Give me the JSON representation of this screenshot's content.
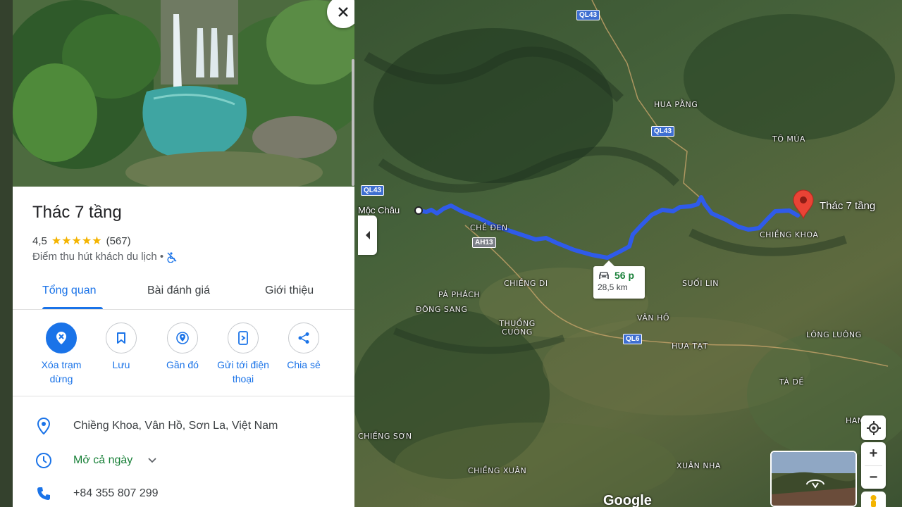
{
  "place": {
    "title": "Thác 7 tầng",
    "rating": "4,5",
    "stars": "★★★★★",
    "review_count": "(567)",
    "category": "Điểm thu hút khách du lịch •"
  },
  "tabs": [
    "Tổng quan",
    "Bài đánh giá",
    "Giới thiệu"
  ],
  "actions": [
    {
      "label": "Xóa trạm dừng",
      "icon": "remove-stop-icon"
    },
    {
      "label": "Lưu",
      "icon": "bookmark-icon"
    },
    {
      "label": "Gần đó",
      "icon": "nearby-icon"
    },
    {
      "label": "Gửi tới điện thoại",
      "icon": "send-to-phone-icon"
    },
    {
      "label": "Chia sẻ",
      "icon": "share-icon"
    }
  ],
  "info": {
    "address": "Chiềng Khoa, Vân Hồ, Sơn La, Việt Nam",
    "hours": "Mở cả ngày",
    "phone": "+84 355 807 299"
  },
  "route": {
    "duration": "56 p",
    "distance": "28,5 km"
  },
  "map": {
    "origin": "Mộc Châu",
    "destination": "Thác 7 tầng",
    "place_labels": [
      "HUA PẰNG",
      "TÔ MÚA",
      "CHIỀNG KHOA",
      "CHỀ ĐEN",
      "CHIỀNG DI",
      "PÁ PHÁCH",
      "ĐÔNG SANG",
      "THUỒNG CUÔNG",
      "SUỐI LIN",
      "VÂN HỒ",
      "HUA TẠT",
      "LÓNG LUÔNG",
      "TÀ DỀ",
      "CHIỀNG SƠN",
      "CHIỀNG XUÂN",
      "XUÂN NHA",
      "HAN"
    ],
    "road_shields": [
      "QL43",
      "QL43",
      "QL43",
      "AH13",
      "QL6"
    ],
    "attribution": "Google"
  },
  "colors": {
    "accent": "#1a73e8",
    "route": "#2f5bea",
    "open_status": "#188038",
    "star": "#f4b400",
    "pin": "#ea4335"
  }
}
